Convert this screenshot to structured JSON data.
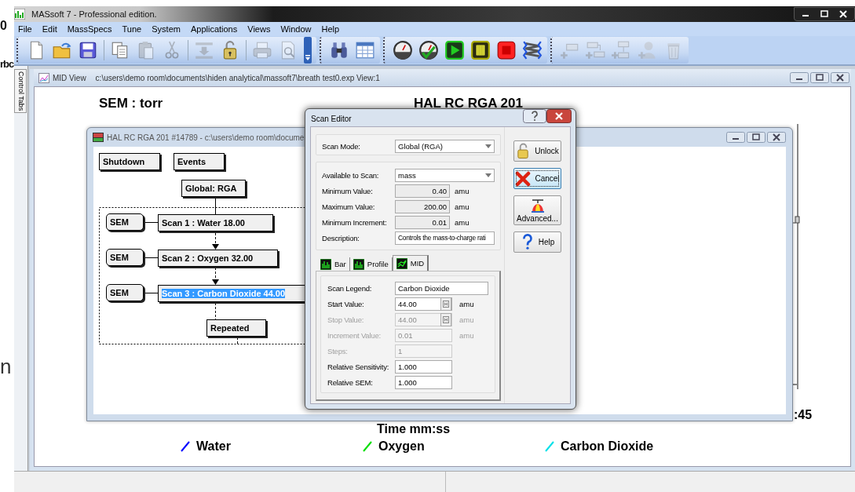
{
  "fragments": [
    "0",
    "rbc",
    "n"
  ],
  "app": {
    "title": "MASsoft 7 -  Professional edition.",
    "menu": [
      "File",
      "Edit",
      "MassSpecs",
      "Tune",
      "System",
      "Applications",
      "Views",
      "Window",
      "Help"
    ],
    "toolbar": [
      {
        "items": [
          {
            "kind": "new",
            "disabled": false
          },
          {
            "kind": "open",
            "disabled": false
          },
          {
            "kind": "save",
            "disabled": false
          },
          {
            "kind": "sep"
          },
          {
            "kind": "copy",
            "disabled": false
          },
          {
            "kind": "paste",
            "disabled": true
          },
          {
            "kind": "cut",
            "disabled": true
          },
          {
            "kind": "sep"
          },
          {
            "kind": "import",
            "disabled": true
          },
          {
            "kind": "lock",
            "disabled": false
          },
          {
            "kind": "sep"
          },
          {
            "kind": "print",
            "disabled": true
          },
          {
            "kind": "preview",
            "disabled": true
          }
        ]
      },
      {
        "items": [
          {
            "kind": "find",
            "disabled": false
          },
          {
            "kind": "table",
            "disabled": false
          }
        ]
      },
      {
        "items": [
          {
            "kind": "gauge",
            "disabled": false
          },
          {
            "kind": "gauge-check",
            "disabled": false
          },
          {
            "kind": "play",
            "disabled": false
          },
          {
            "kind": "pause",
            "disabled": false
          },
          {
            "kind": "stop",
            "disabled": false
          },
          {
            "kind": "spring",
            "disabled": false
          }
        ]
      },
      {
        "items": [
          {
            "kind": "add-row",
            "disabled": true
          },
          {
            "kind": "add-after",
            "disabled": true
          },
          {
            "kind": "add-below",
            "disabled": true
          },
          {
            "kind": "add-user",
            "disabled": true
          },
          {
            "kind": "delete",
            "disabled": true
          }
        ]
      }
    ],
    "side_tab": "Control Tabs"
  },
  "mid_view": {
    "title": "MID View",
    "path": "c:\\users\\demo room\\documents\\hiden analytical\\massoft7\\breath test0.exp View:1",
    "units": "SEM : torr",
    "chart_title": "HAL RC RGA 201",
    "tick_label": ":45",
    "x_label": "Time  mm:ss",
    "legend": [
      {
        "label": "Water",
        "color": "#0000ff"
      },
      {
        "label": "Oxygen",
        "color": "#00dd00"
      },
      {
        "label": "Carbon Dioxide",
        "color": "#00e0e8"
      }
    ]
  },
  "hal_window": {
    "title": "HAL RC RGA 201 #14789 - c:\\users\\demo room\\docume",
    "buttons": [
      "Shutdown",
      "Events"
    ],
    "global": "Global: RGA",
    "scans": [
      {
        "sem": "SEM",
        "label": "Scan 1 : Water 18.00",
        "selected": false
      },
      {
        "sem": "SEM",
        "label": "Scan 2 : Oxygen 32.00",
        "selected": false
      },
      {
        "sem": "SEM",
        "label": "Scan 3 : Carbon Dioxide 44.00",
        "selected": true
      }
    ],
    "repeated": "Repeated"
  },
  "scan_editor": {
    "title": "Scan Editor",
    "scan_mode": {
      "label": "Scan Mode:",
      "value": "Global (RGA)"
    },
    "params": [
      {
        "kind": "dropdown",
        "label": "Available to Scan:",
        "value": "mass"
      },
      {
        "kind": "readonly",
        "label": "Minimum Value:",
        "value": "0.40",
        "unit": "amu"
      },
      {
        "kind": "readonly",
        "label": "Maximum Value:",
        "value": "200.00",
        "unit": "amu"
      },
      {
        "kind": "readonly",
        "label": "Minimum Increment:",
        "value": "0.01",
        "unit": "amu"
      },
      {
        "kind": "text",
        "label": "Description:",
        "value": "Controls the mass-to-charge rati"
      }
    ],
    "tabs": [
      {
        "label": "Bar",
        "selected": false
      },
      {
        "label": "Profile",
        "selected": false
      },
      {
        "label": "MID",
        "selected": true
      }
    ],
    "fields": [
      {
        "kind": "wide",
        "label": "Scan Legend:",
        "value": "Carbon Dioxide",
        "disabled": false
      },
      {
        "kind": "spin",
        "label": "Start Value:",
        "value": "44.00",
        "unit": "amu",
        "disabled": false
      },
      {
        "kind": "spin",
        "label": "Stop Value:",
        "value": "44.00",
        "unit": "amu",
        "disabled": true
      },
      {
        "kind": "text",
        "label": "Increment Value:",
        "value": "0.01",
        "unit": "amu",
        "disabled": true
      },
      {
        "kind": "text",
        "label": "Steps:",
        "value": "1",
        "disabled": true
      },
      {
        "kind": "text",
        "label": "Relative Sensitivity:",
        "value": "1.000",
        "disabled": false
      },
      {
        "kind": "text",
        "label": "Relative SEM:",
        "value": "1.000",
        "disabled": false
      }
    ],
    "buttons": [
      {
        "kind": "unlock",
        "label": "Unlock",
        "focused": false
      },
      {
        "kind": "cancel",
        "label": "Cancel",
        "focused": true
      },
      {
        "kind": "advanced",
        "label": "Advanced...",
        "focused": false
      },
      {
        "kind": "help",
        "label": "Help",
        "focused": false
      }
    ]
  }
}
